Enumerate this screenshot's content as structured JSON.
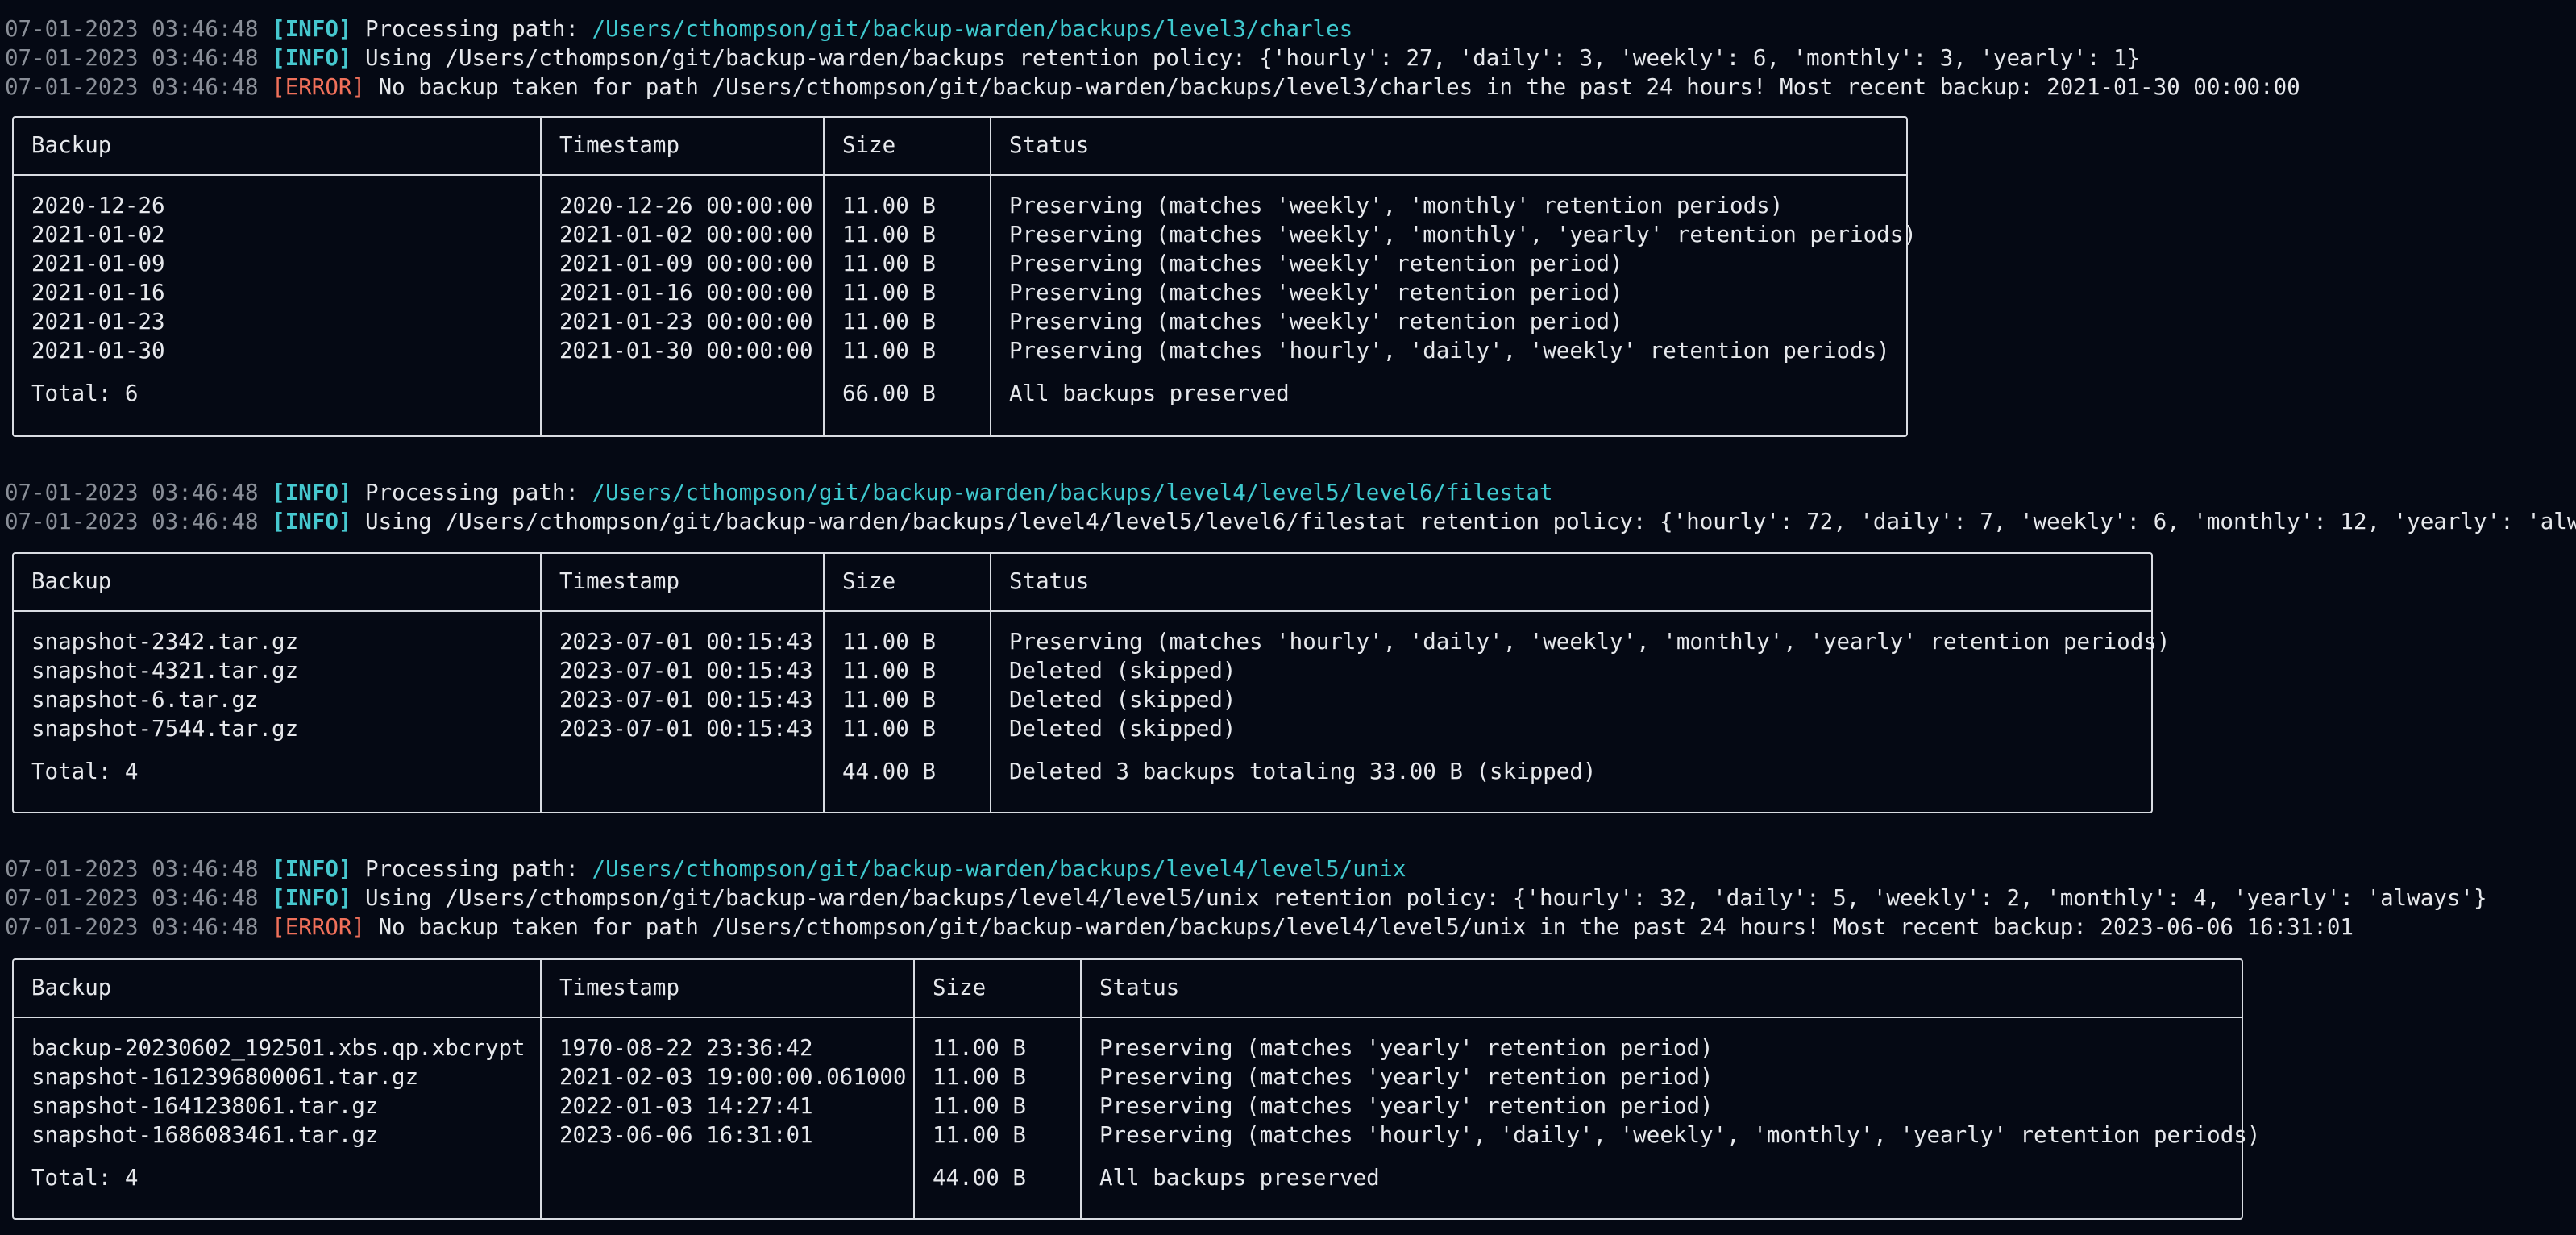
{
  "colors": {
    "background": "#050914",
    "timestamp": "#8a8f98",
    "info": "#46c8cf",
    "error": "#f0705a",
    "path": "#3fc9cf",
    "text": "#e6e8ec",
    "border": "#d9dce2"
  },
  "sections": [
    {
      "logs": [
        {
          "ts": "07-01-2023 03:46:48",
          "level": "[INFO]",
          "kind": "info",
          "pre": "Processing path: ",
          "path": "/Users/cthompson/git/backup-warden/backups/level3/charles",
          "post": ""
        },
        {
          "ts": "07-01-2023 03:46:48",
          "level": "[INFO]",
          "kind": "info",
          "pre": "Using ",
          "path": "",
          "post": "/Users/cthompson/git/backup-warden/backups retention policy: {'hourly': 27, 'daily': 3, 'weekly': 6, 'monthly': 3, 'yearly': 1}"
        },
        {
          "ts": "07-01-2023 03:46:48",
          "level": "[ERROR]",
          "kind": "error",
          "pre": "No backup taken for path /Users/cthompson/git/backup-warden/backups/level3/charles in the past 24 hours! Most recent backup: 2021-01-30 00:00:00",
          "path": "",
          "post": ""
        }
      ],
      "table": {
        "headers": [
          "Backup",
          "Timestamp",
          "Size",
          "Status"
        ],
        "rows": [
          [
            "2020-12-26",
            "2020-12-26 00:00:00",
            "11.00 B",
            "Preserving (matches 'weekly', 'monthly' retention periods)"
          ],
          [
            "2021-01-02",
            "2021-01-02 00:00:00",
            "11.00 B",
            "Preserving (matches 'weekly', 'monthly', 'yearly' retention periods)"
          ],
          [
            "2021-01-09",
            "2021-01-09 00:00:00",
            "11.00 B",
            "Preserving (matches 'weekly' retention period)"
          ],
          [
            "2021-01-16",
            "2021-01-16 00:00:00",
            "11.00 B",
            "Preserving (matches 'weekly' retention period)"
          ],
          [
            "2021-01-23",
            "2021-01-23 00:00:00",
            "11.00 B",
            "Preserving (matches 'weekly' retention period)"
          ],
          [
            "2021-01-30",
            "2021-01-30 00:00:00",
            "11.00 B",
            "Preserving (matches 'hourly', 'daily', 'weekly' retention periods)"
          ]
        ],
        "footer": [
          "Total: 6",
          "",
          "66.00 B",
          "All backups preserved"
        ]
      }
    },
    {
      "logs": [
        {
          "ts": "07-01-2023 03:46:48",
          "level": "[INFO]",
          "kind": "info",
          "pre": "Processing path: ",
          "path": "/Users/cthompson/git/backup-warden/backups/level4/level5/level6/filestat",
          "post": ""
        },
        {
          "ts": "07-01-2023 03:46:48",
          "level": "[INFO]",
          "kind": "info",
          "pre": "Using ",
          "path": "",
          "post": "/Users/cthompson/git/backup-warden/backups/level4/level5/level6/filestat retention policy: {'hourly': 72, 'daily': 7, 'weekly': 6, 'monthly': 12, 'yearly': 'always'}"
        }
      ],
      "table": {
        "headers": [
          "Backup",
          "Timestamp",
          "Size",
          "Status"
        ],
        "rows": [
          [
            "snapshot-2342.tar.gz",
            "2023-07-01 00:15:43",
            "11.00 B",
            "Preserving (matches 'hourly', 'daily', 'weekly', 'monthly', 'yearly' retention periods)"
          ],
          [
            "snapshot-4321.tar.gz",
            "2023-07-01 00:15:43",
            "11.00 B",
            "Deleted (skipped)"
          ],
          [
            "snapshot-6.tar.gz",
            "2023-07-01 00:15:43",
            "11.00 B",
            "Deleted (skipped)"
          ],
          [
            "snapshot-7544.tar.gz",
            "2023-07-01 00:15:43",
            "11.00 B",
            "Deleted (skipped)"
          ]
        ],
        "footer": [
          "Total: 4",
          "",
          "44.00 B",
          "Deleted 3 backups totaling 33.00 B (skipped)"
        ]
      }
    },
    {
      "logs": [
        {
          "ts": "07-01-2023 03:46:48",
          "level": "[INFO]",
          "kind": "info",
          "pre": "Processing path: ",
          "path": "/Users/cthompson/git/backup-warden/backups/level4/level5/unix",
          "post": ""
        },
        {
          "ts": "07-01-2023 03:46:48",
          "level": "[INFO]",
          "kind": "info",
          "pre": "Using ",
          "path": "",
          "post": "/Users/cthompson/git/backup-warden/backups/level4/level5/unix retention policy: {'hourly': 32, 'daily': 5, 'weekly': 2, 'monthly': 4, 'yearly': 'always'}"
        },
        {
          "ts": "07-01-2023 03:46:48",
          "level": "[ERROR]",
          "kind": "error",
          "pre": "No backup taken for path /Users/cthompson/git/backup-warden/backups/level4/level5/unix in the past 24 hours! Most recent backup: 2023-06-06 16:31:01",
          "path": "",
          "post": ""
        }
      ],
      "table": {
        "headers": [
          "Backup",
          "Timestamp",
          "Size",
          "Status"
        ],
        "rows": [
          [
            "backup-20230602_192501.xbs.qp.xbcrypt",
            "1970-08-22 23:36:42",
            "11.00 B",
            "Preserving (matches 'yearly' retention period)"
          ],
          [
            "snapshot-1612396800061.tar.gz",
            "2021-02-03 19:00:00.061000",
            "11.00 B",
            "Preserving (matches 'yearly' retention period)"
          ],
          [
            "snapshot-1641238061.tar.gz",
            "2022-01-03 14:27:41",
            "11.00 B",
            "Preserving (matches 'yearly' retention period)"
          ],
          [
            "snapshot-1686083461.tar.gz",
            "2023-06-06 16:31:01",
            "11.00 B",
            "Preserving (matches 'hourly', 'daily', 'weekly', 'monthly', 'yearly' retention periods)"
          ]
        ],
        "footer": [
          "Total: 4",
          "",
          "44.00 B",
          "All backups preserved"
        ]
      }
    }
  ]
}
